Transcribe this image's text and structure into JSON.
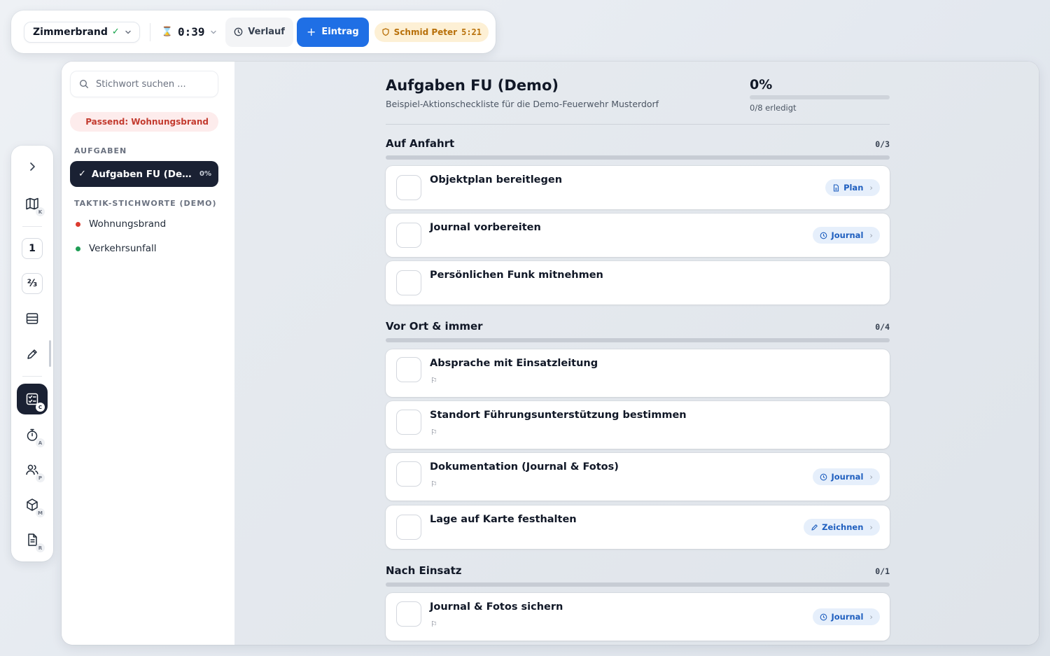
{
  "topbar": {
    "mission": "Zimmerbrand",
    "timer": "0:39",
    "history_label": "Verlauf",
    "entry_label": "Eintrag",
    "user_name": "Schmid Peter",
    "user_time": "5:21"
  },
  "rail": {
    "items": [
      {
        "icon": "chevron-right-icon"
      },
      {
        "icon": "map-icon",
        "key": "K"
      },
      {
        "icon": "one-icon",
        "text": "1"
      },
      {
        "icon": "fraction-icon",
        "text": "²⁄₃"
      },
      {
        "icon": "table-icon"
      },
      {
        "icon": "pencil-icon"
      },
      {
        "icon": "checklist-icon",
        "key": "C",
        "active": true
      },
      {
        "icon": "stopwatch-icon",
        "key": "A"
      },
      {
        "icon": "users-icon",
        "key": "P"
      },
      {
        "icon": "cube-icon",
        "key": "M"
      },
      {
        "icon": "document-icon",
        "key": "R"
      }
    ]
  },
  "sidebar": {
    "search_placeholder": "Stichwort suchen ...",
    "match_label": "Passend: Wohnungsbrand",
    "tasks_heading": "AUFGABEN",
    "active_task": "Aufgaben FU (Demo)",
    "active_task_pct": "0%",
    "keywords_heading": "TAKTIK-STICHWORTE (DEMO)",
    "keywords": [
      {
        "label": "Wohnungsbrand",
        "color": "#dc3b2f"
      },
      {
        "label": "Verkehrsunfall",
        "color": "#1f9d55"
      }
    ]
  },
  "main": {
    "title": "Aufgaben FU (Demo)",
    "subtitle": "Beispiel-Aktionscheckliste für die Demo-Feuerwehr Musterdorf",
    "progress_pct": "0%",
    "progress_value": 0,
    "progress_done": "0/8 erledigt",
    "groups": [
      {
        "title": "Auf Anfahrt",
        "count": "0/3",
        "items": [
          {
            "title": "Objektplan bereitlegen",
            "action": "Plan",
            "action_icon": "document-icon"
          },
          {
            "title": "Journal vorbereiten",
            "action": "Journal",
            "action_icon": "clock-icon"
          },
          {
            "title": "Persönlichen Funk mitnehmen"
          }
        ]
      },
      {
        "title": "Vor Ort & immer",
        "count": "0/4",
        "items": [
          {
            "title": "Absprache mit Einsatzleitung",
            "flag": true
          },
          {
            "title": "Standort Führungsunterstützung bestimmen",
            "flag": true
          },
          {
            "title": "Dokumentation (Journal & Fotos)",
            "flag": true,
            "action": "Journal",
            "action_icon": "clock-icon"
          },
          {
            "title": "Lage auf Karte festhalten",
            "action": "Zeichnen",
            "action_icon": "pencil-icon"
          }
        ]
      },
      {
        "title": "Nach Einsatz",
        "count": "0/1",
        "items": [
          {
            "title": "Journal & Fotos sichern",
            "flag": true,
            "action": "Journal",
            "action_icon": "clock-icon"
          }
        ]
      }
    ]
  },
  "colors": {
    "accent": "#1f6fe5",
    "dark": "#1a2133",
    "warning_bg": "#fdf0d5",
    "warning_text": "#b8700a",
    "danger_bg": "#fdecec",
    "danger_text": "#c33b2f"
  }
}
